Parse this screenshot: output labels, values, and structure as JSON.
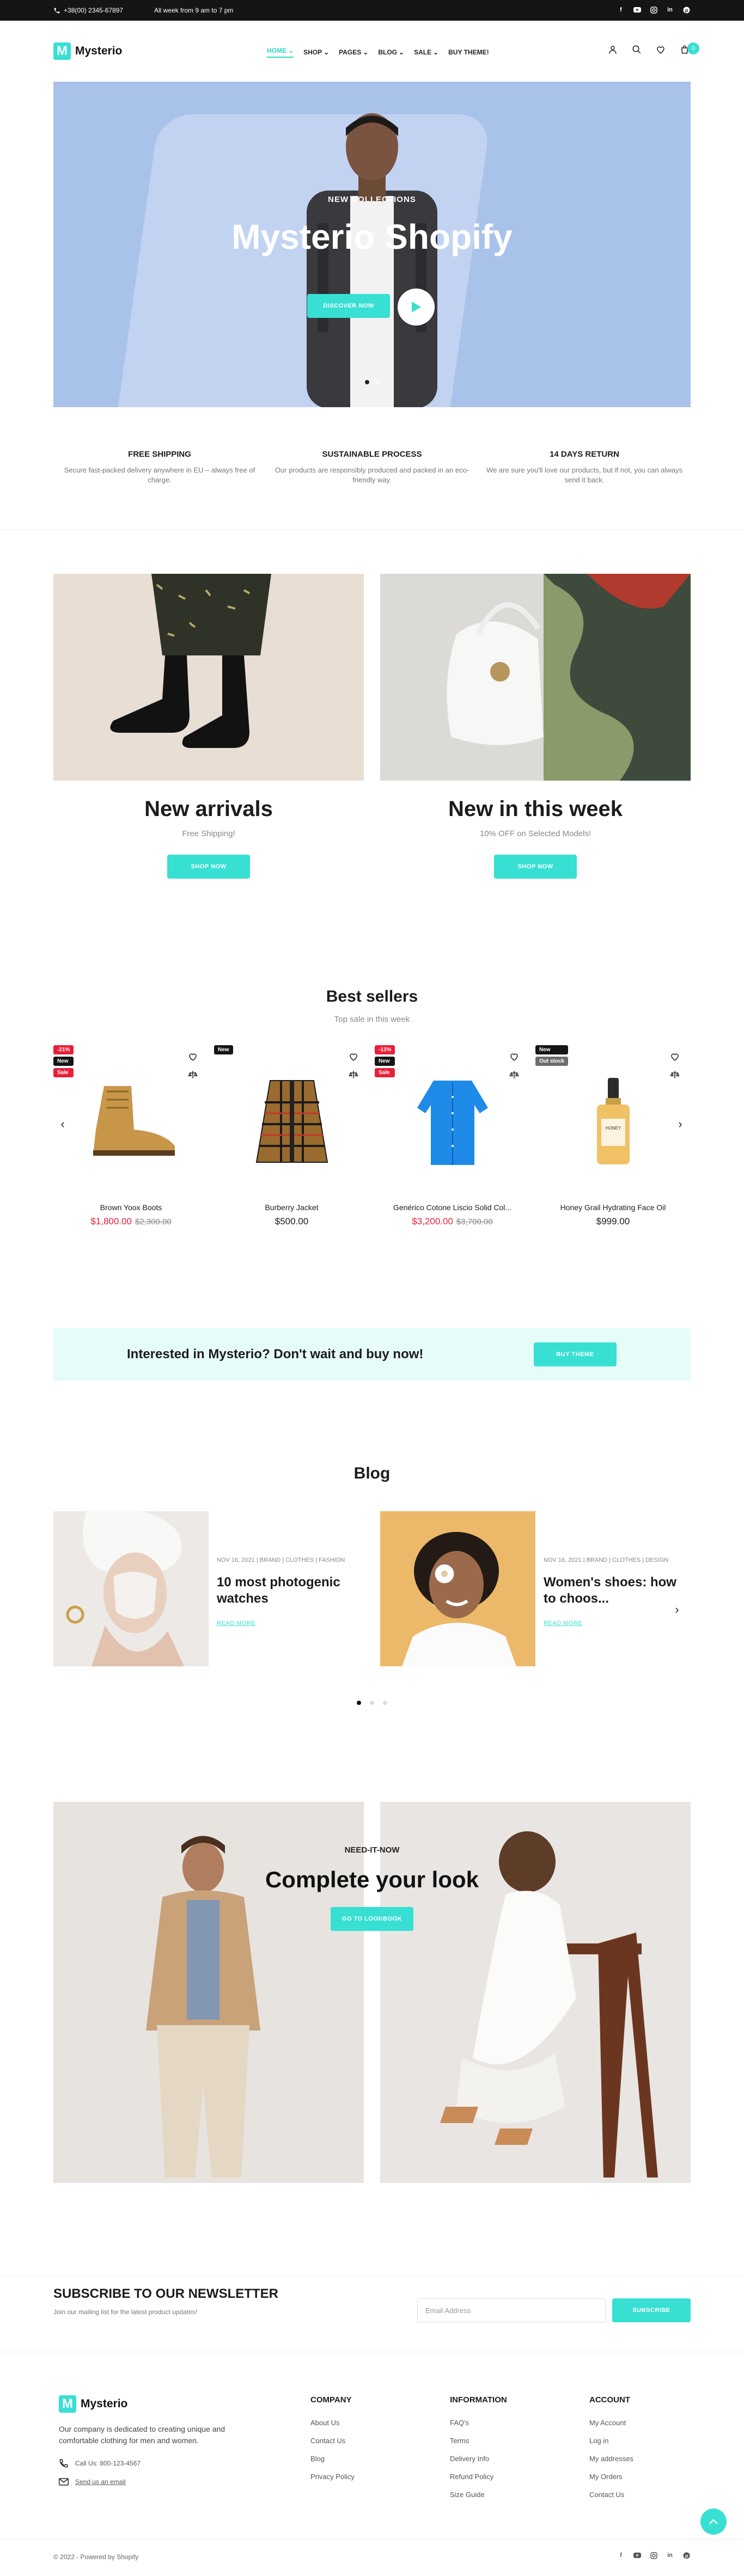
{
  "topbar": {
    "phone": "+38(00) 2345-67897",
    "hours": "All week from 9 am to 7 pm",
    "social": [
      "facebook-icon",
      "youtube-icon",
      "instagram-icon",
      "linkedin-icon",
      "pinterest-icon"
    ]
  },
  "header": {
    "logo_letter": "M",
    "logo_text": "Mysterio",
    "nav": [
      {
        "label": "HOME",
        "active": true,
        "dropdown": true
      },
      {
        "label": "SHOP",
        "active": false,
        "dropdown": true
      },
      {
        "label": "PAGES",
        "active": false,
        "dropdown": true
      },
      {
        "label": "BLOG",
        "active": false,
        "dropdown": true
      },
      {
        "label": "SALE",
        "active": false,
        "dropdown": true
      },
      {
        "label": "BUY THEME!",
        "active": false,
        "dropdown": false
      }
    ],
    "cart_count": "0"
  },
  "hero": {
    "subtitle": "NEW COLLECTIONS",
    "title": "Mysterio Shopify",
    "button": "DISCOVER NOW"
  },
  "features": [
    {
      "title": "FREE SHIPPING",
      "text": "Secure fast-packed delivery anywhere in EU – always free of charge."
    },
    {
      "title": "SUSTAINABLE PROCESS",
      "text": "Our products are responsibly produced and packed in an eco-friendly way."
    },
    {
      "title": "14 DAYS RETURN",
      "text": "We are sure you'll love our products, but if not, you can always send it back."
    }
  ],
  "categories": [
    {
      "title": "New arrivals",
      "text": "Free Shipping!",
      "button": "SHOP NOW"
    },
    {
      "title": "New in this week",
      "text": "10% OFF on Selected Models!",
      "button": "SHOP NOW"
    }
  ],
  "bestsellers": {
    "title": "Best sellers",
    "subtitle": "Top sale in this week",
    "products": [
      {
        "name": "Brown Yoox Boots",
        "price": "$1,800.00",
        "old_price": "$2,300.00",
        "badges": [
          "-21%",
          "New",
          "Sale"
        ]
      },
      {
        "name": "Burberry Jacket",
        "price": "$500.00",
        "old_price": "",
        "badges": [
          "New"
        ]
      },
      {
        "name": "Genérico Cotone Liscio Solid Col...",
        "price": "$3,200.00",
        "old_price": "$3,700.00",
        "badges": [
          "-13%",
          "New",
          "Sale"
        ]
      },
      {
        "name": "Honey Grail Hydrating Face Oil",
        "price": "$999.00",
        "old_price": "",
        "badges": [
          "New",
          "Out stock"
        ]
      }
    ]
  },
  "banner": {
    "text": "Interested in Mysterio? Don't wait and buy now!",
    "button": "BUY THEME"
  },
  "blog": {
    "title": "Blog",
    "posts": [
      {
        "meta": "NOV 16, 2021 | BRAND | CLOTHES | FASHION",
        "title": "10 most photogenic watches",
        "more": "READ MORE"
      },
      {
        "meta": "NOV 16, 2021 | BRAND | CLOTHES | DESIGN",
        "title": "Women's shoes: how to choos...",
        "more": "READ MORE"
      }
    ]
  },
  "lookbook": {
    "eyebrow": "NEED-IT-NOW",
    "title": "Complete your look",
    "button": "GO TO LOOKBOOK"
  },
  "newsletter": {
    "title": "SUBSCRIBE TO OUR NEWSLETTER",
    "text": "Join our mailing list for the latest product updates!",
    "placeholder": "Email Address",
    "button": "SUBSCRIBE"
  },
  "footer": {
    "about": "Our company is dedicated to creating unique and comfortable clothing for men and women.",
    "phone": "Call Us: 800-123-4567",
    "email": "Send us an email",
    "columns": [
      {
        "title": "COMPANY",
        "links": [
          "About Us",
          "Contact Us",
          "Blog",
          "Privacy Policy"
        ]
      },
      {
        "title": "INFORMATION",
        "links": [
          "FAQ's",
          "Terms",
          "Delivery Info",
          "Refund Policy",
          "Size Guide"
        ]
      },
      {
        "title": "ACCOUNT",
        "links": [
          "My Account",
          "Log in",
          "My addresses",
          "My Orders",
          "Contact Us"
        ]
      }
    ],
    "copyright": "© 2022 - Powered by Shopify"
  },
  "colors": {
    "accent": "#37e0d3",
    "sale": "#e7203a",
    "dark": "#151515"
  }
}
